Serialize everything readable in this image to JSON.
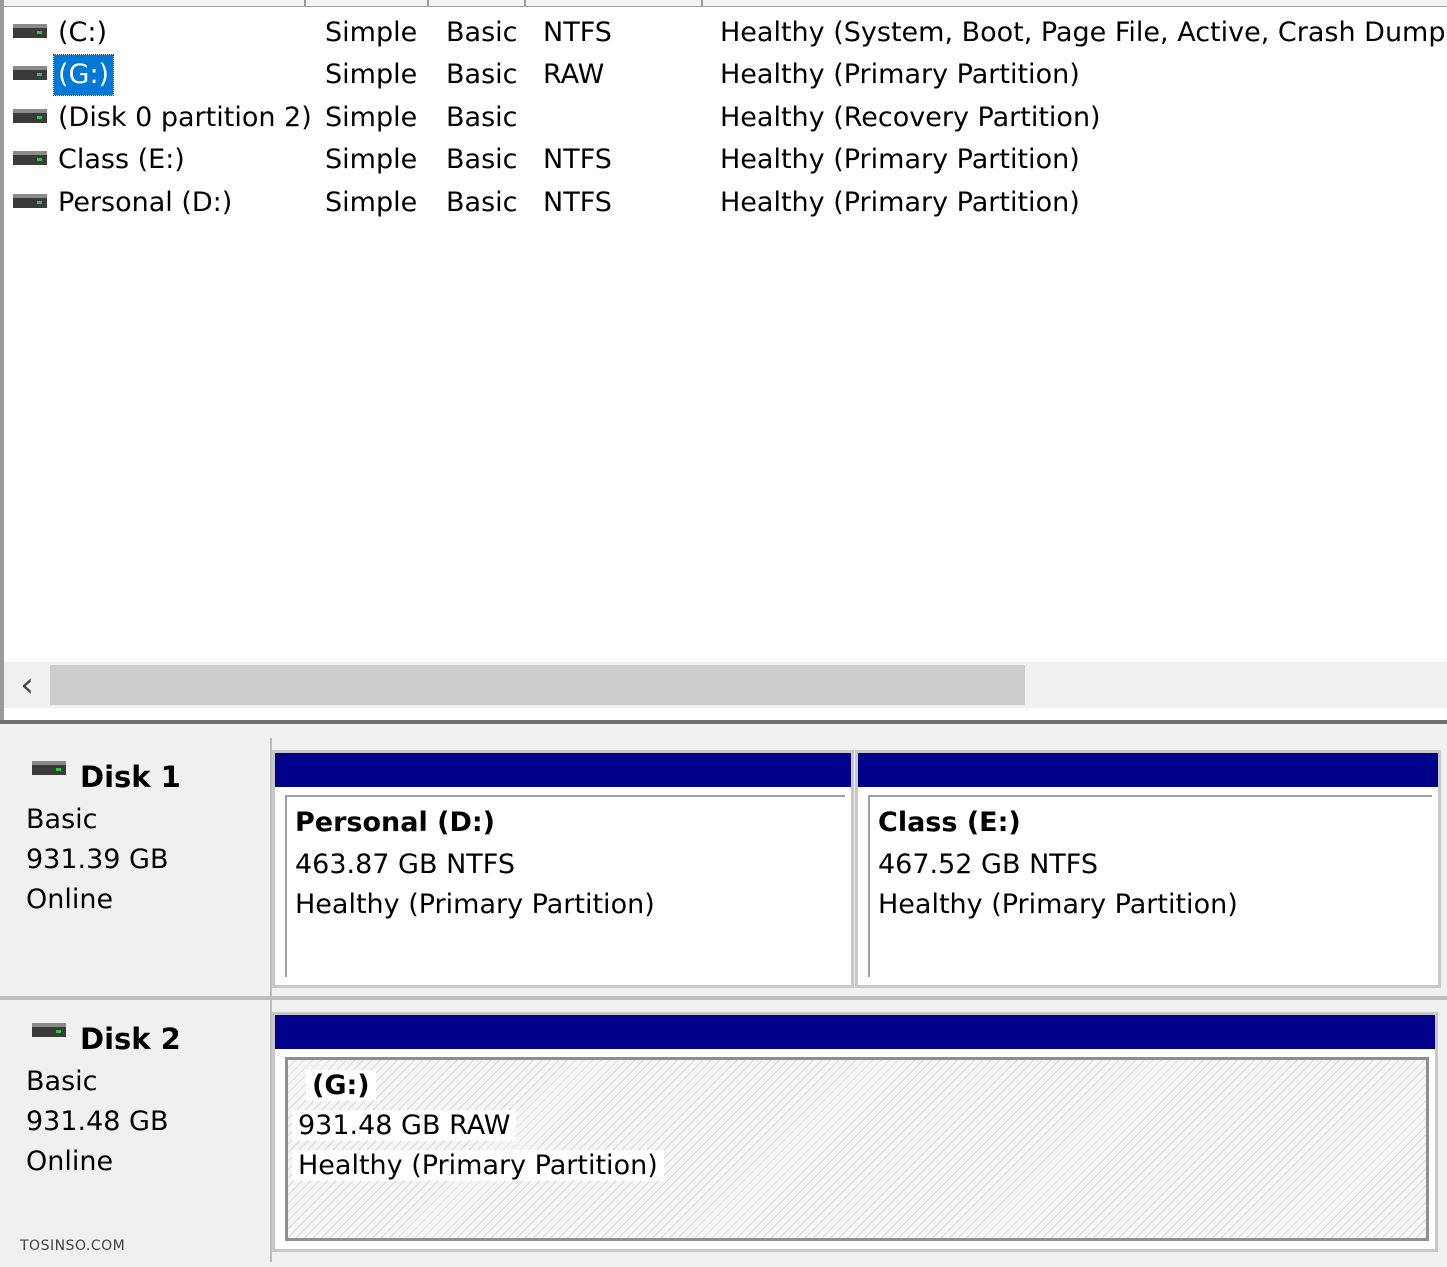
{
  "volumes": [
    {
      "name": "(C:)",
      "layout": "Simple",
      "type": "Basic",
      "fs": "NTFS",
      "status": "Healthy (System, Boot, Page File, Active, Crash Dump, P"
    },
    {
      "name": "(G:)",
      "layout": "Simple",
      "type": "Basic",
      "fs": "RAW",
      "status": "Healthy (Primary Partition)"
    },
    {
      "name": "(Disk 0 partition 2)",
      "layout": "Simple",
      "type": "Basic",
      "fs": "",
      "status": "Healthy (Recovery Partition)"
    },
    {
      "name": "Class (E:)",
      "layout": "Simple",
      "type": "Basic",
      "fs": "NTFS",
      "status": "Healthy (Primary Partition)"
    },
    {
      "name": "Personal (D:)",
      "layout": "Simple",
      "type": "Basic",
      "fs": "NTFS",
      "status": "Healthy (Primary Partition)"
    }
  ],
  "selected_volume": "(G:)",
  "scrollbar": {
    "arrow_glyph": "‹"
  },
  "disks": [
    {
      "name": "Disk 1",
      "type": "Basic",
      "size": "931.39 GB",
      "state": "Online",
      "partitions": [
        {
          "name": "Personal  (D:)",
          "size_fs": "463.87 GB NTFS",
          "status": "Healthy (Primary Partition)"
        },
        {
          "name": "Class  (E:)",
          "size_fs": "467.52 GB NTFS",
          "status": "Healthy (Primary Partition)"
        }
      ]
    },
    {
      "name": "Disk 2",
      "type": "Basic",
      "size": "931.48 GB",
      "state": "Online",
      "partitions": [
        {
          "name": "(G:)",
          "size_fs": "931.48 GB RAW",
          "status": "Healthy (Primary Partition)"
        }
      ]
    }
  ],
  "watermark": "TOSINSO.COM",
  "colors": {
    "partition_bar": "#00008b",
    "selection": "#0078d7"
  }
}
